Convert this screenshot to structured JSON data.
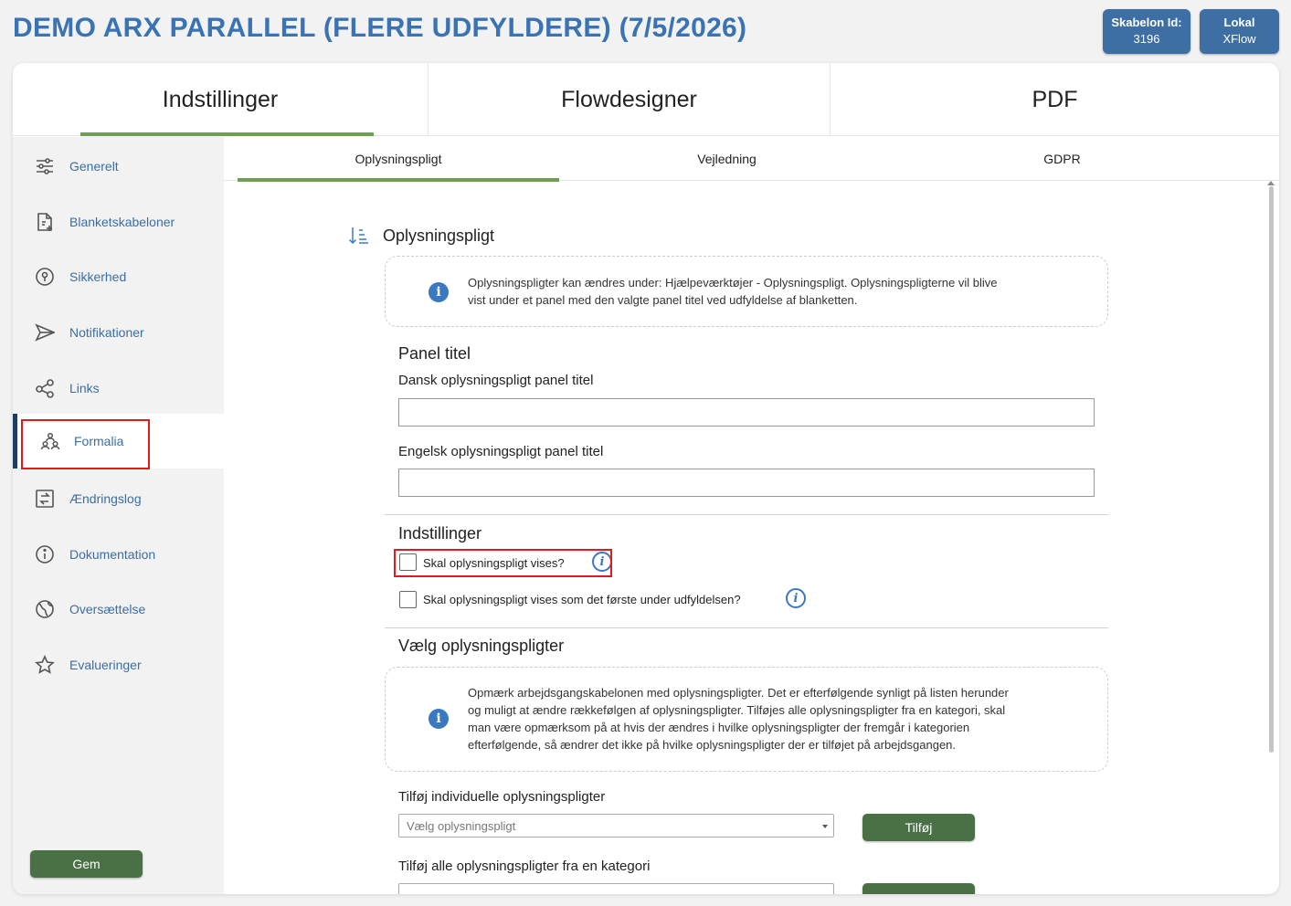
{
  "header": {
    "title": "DEMO ARX PARALLEL (FLERE UDFYLDERE) (7/5/2026)",
    "template_badge": {
      "label": "Skabelon Id:",
      "value": "3196"
    },
    "env_badge": {
      "label": "Lokal",
      "value": "XFlow"
    }
  },
  "top_tabs": [
    {
      "label": "Indstillinger",
      "active": true
    },
    {
      "label": "Flowdesigner",
      "active": false
    },
    {
      "label": "PDF",
      "active": false
    }
  ],
  "sidebar": {
    "items": [
      {
        "label": "Generelt",
        "icon": "sliders-icon"
      },
      {
        "label": "Blanketskabeloner",
        "icon": "document-add-icon"
      },
      {
        "label": "Sikkerhed",
        "icon": "lock-icon"
      },
      {
        "label": "Notifikationer",
        "icon": "send-icon"
      },
      {
        "label": "Links",
        "icon": "share-icon"
      },
      {
        "label": "Formalia",
        "icon": "users-icon",
        "active": true
      },
      {
        "label": "Ændringslog",
        "icon": "swap-icon"
      },
      {
        "label": "Dokumentation",
        "icon": "info-icon"
      },
      {
        "label": "Oversættelse",
        "icon": "globe-icon"
      },
      {
        "label": "Evalueringer",
        "icon": "star-icon"
      }
    ],
    "save_label": "Gem"
  },
  "sub_tabs": [
    {
      "label": "Oplysningspligt",
      "active": true
    },
    {
      "label": "Vejledning",
      "active": false
    },
    {
      "label": "GDPR",
      "active": false
    }
  ],
  "content": {
    "section_title": "Oplysningspligt",
    "info1_icon": "i",
    "info1_line1": "Oplysningspligter kan ændres under: Hjælpeværktøjer - Oplysningspligt. Oplysningspligterne vil blive",
    "info1_line2": "vist under et panel med den valgte panel titel ved udfyldelse af blanketten.",
    "panel_title_heading": "Panel titel",
    "danish_label": "Dansk oplysningspligt panel titel",
    "danish_value": "",
    "english_label": "Engelsk oplysningspligt panel titel",
    "english_value": "",
    "settings_heading": "Indstillinger",
    "cb1_label": "Skal oplysningspligt vises?",
    "cb1_checked": false,
    "cb2_label": "Skal oplysningspligt vises som det første under udfyldelsen?",
    "cb2_checked": false,
    "help_glyph": "i",
    "choose_heading": "Vælg oplysningspligter",
    "info2_icon": "i",
    "info2_line1": "Opmærk arbejdsgangskabelonen med oplysningspligter. Det er efterfølgende synligt på listen herunder",
    "info2_line2": "og muligt at ændre rækkefølgen af oplysningspligter. Tilføjes alle oplysningspligter fra en kategori, skal",
    "info2_line3": "man være opmærksom på at hvis der ændres i hvilke oplysningspligter der fremgår i kategorien",
    "info2_line4": "efterfølgende, så ændrer det ikke på hvilke oplysningspligter der er tilføjet på arbejdsgangen.",
    "individual_label": "Tilføj individuelle oplysningspligter",
    "individual_placeholder": "Vælg oplysningspligt",
    "add_label": "Tilføj",
    "category_label": "Tilføj alle oplysningspligter fra en kategori"
  },
  "colors": {
    "title_blue": "#3a73b3",
    "badge_blue": "#3d6fa5",
    "accent_green": "#6b9f53",
    "button_green": "#4a7146",
    "highlight_red": "#e01b1b",
    "link_blue": "#3a6ea5"
  }
}
